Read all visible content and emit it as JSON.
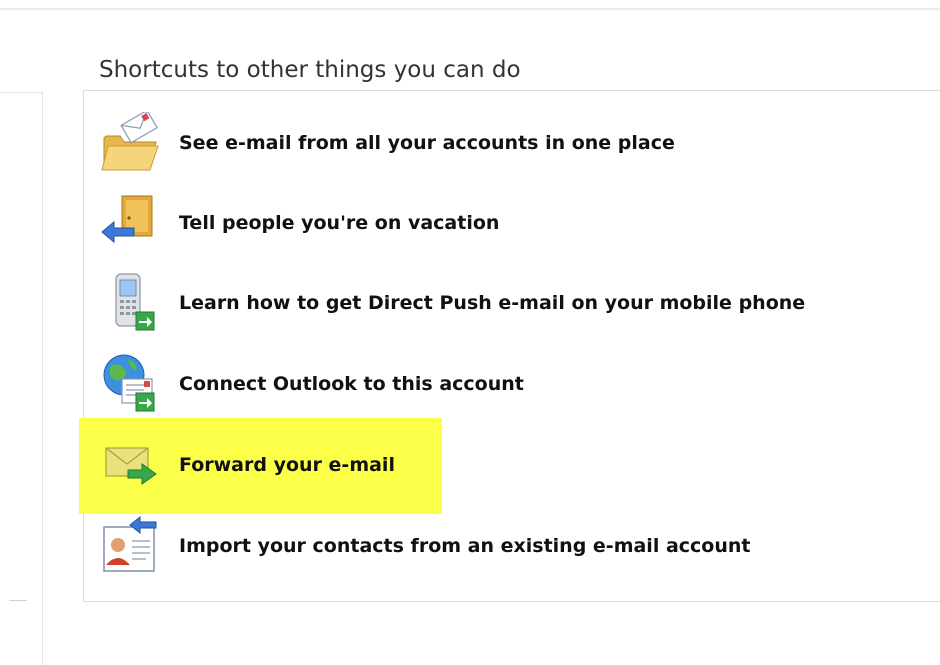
{
  "section": {
    "title": "Shortcuts to other things you can do"
  },
  "shortcuts": [
    {
      "label": "See e-mail from all your accounts in one place",
      "icon": "folder-with-mail-icon"
    },
    {
      "label": "Tell people you're on vacation",
      "icon": "door-exit-icon"
    },
    {
      "label": "Learn how to get Direct Push e-mail on your mobile phone",
      "icon": "mobile-phone-icon"
    },
    {
      "label": "Connect Outlook to this account",
      "icon": "globe-mail-icon"
    },
    {
      "label": "Forward your e-mail",
      "icon": "forward-envelope-icon",
      "highlighted": true
    },
    {
      "label": "Import your contacts from an existing e-mail account",
      "icon": "contact-card-import-icon"
    }
  ],
  "colors": {
    "highlight": "#fbff47",
    "panel_border": "#dcdcdc",
    "title_text": "#333333"
  }
}
